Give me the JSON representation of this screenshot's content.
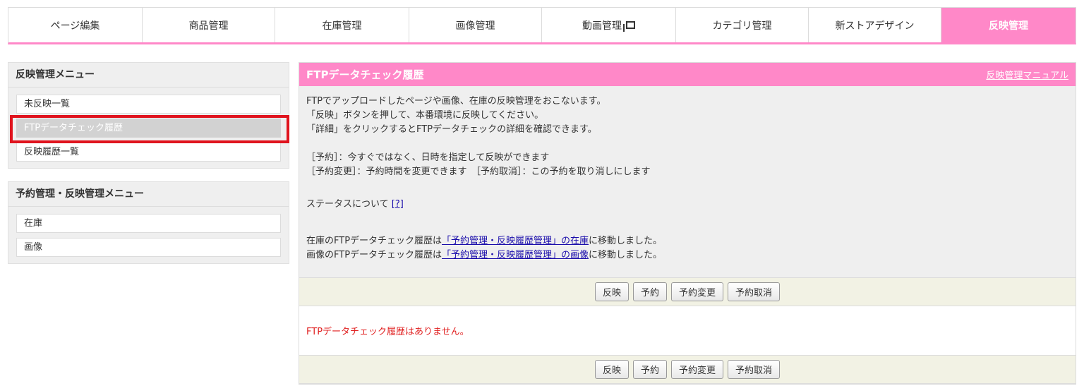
{
  "topnav": {
    "tabs": [
      {
        "label": "ページ編集",
        "active": false
      },
      {
        "label": "商品管理",
        "active": false
      },
      {
        "label": "在庫管理",
        "active": false
      },
      {
        "label": "画像管理",
        "active": false
      },
      {
        "label": "動画管理",
        "active": false,
        "icon": "external-window-icon"
      },
      {
        "label": "カテゴリ管理",
        "active": false
      },
      {
        "label": "新ストアデザイン",
        "active": false
      },
      {
        "label": "反映管理",
        "active": true
      }
    ]
  },
  "sidebar": {
    "menu1": {
      "title": "反映管理メニュー",
      "items": [
        "未反映一覧",
        "FTPデータチェック履歴",
        "反映履歴一覧"
      ],
      "selected_index": 1
    },
    "menu2": {
      "title": "予約管理・反映管理メニュー",
      "items": [
        "在庫",
        "画像"
      ]
    }
  },
  "main": {
    "title": "FTPデータチェック履歴",
    "manual_link": "反映管理マニュアル",
    "desc": {
      "line1": "FTPでアップロードしたページや画像、在庫の反映管理をおこないます。",
      "line2": "「反映」ボタンを押して、本番環境に反映してください。",
      "line3": "「詳細」をクリックするとFTPデータチェックの詳細を確認できます。",
      "line4": "［予約］：今すぐではなく、日時を指定して反映ができます",
      "line5": "［予約変更］：予約時間を変更できます　［予約取消］：この予約を取り消しにします",
      "status_text": "ステータスについて",
      "status_help": "[?]",
      "move1_prefix": "在庫のFTPデータチェック履歴は",
      "move1_link": "「予約管理・反映履歴管理」の在庫",
      "move1_suffix": "に移動しました。",
      "move2_prefix": "画像のFTPデータチェック履歴は",
      "move2_link": "「予約管理・反映履歴管理」の画像",
      "move2_suffix": "に移動しました。"
    },
    "buttons": {
      "reflect": "反映",
      "reserve": "予約",
      "change": "予約変更",
      "cancel": "予約取消"
    },
    "empty_message": "FTPデータチェック履歴はありません。"
  },
  "colors": {
    "accent_pink": "#ff88c8",
    "highlight_red": "#e0141e",
    "empty_text_red": "#e01e1e",
    "link_blue": "#1a0dab"
  }
}
